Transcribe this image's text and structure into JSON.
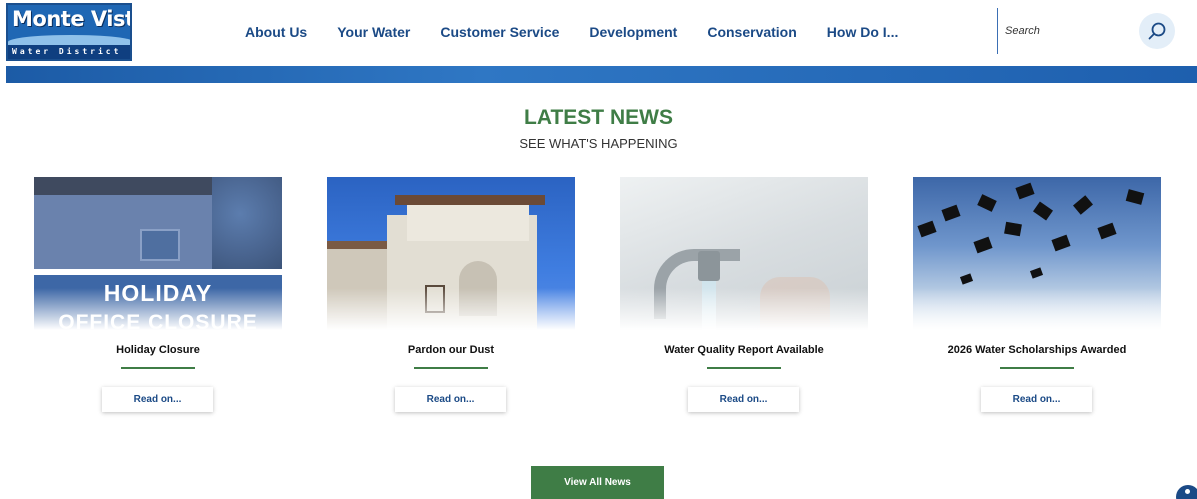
{
  "site": {
    "logo_top": "Monte Vista",
    "logo_bottom": "Water District"
  },
  "nav": {
    "items": [
      {
        "label": "About Us"
      },
      {
        "label": "Your Water"
      },
      {
        "label": "Customer Service"
      },
      {
        "label": "Development"
      },
      {
        "label": "Conservation"
      },
      {
        "label": "How Do I..."
      }
    ]
  },
  "search": {
    "placeholder": "Search",
    "icon": "search-icon"
  },
  "news": {
    "title": "LATEST NEWS",
    "subtitle": "SEE WHAT'S HAPPENING",
    "cards": [
      {
        "title": "Holiday Closure",
        "button": "Read on...",
        "image_text_1": "HOLIDAY",
        "image_text_2": "OFFICE CLOSURE"
      },
      {
        "title": "Pardon our Dust",
        "button": "Read on..."
      },
      {
        "title": "Water Quality Report Available",
        "button": "Read on..."
      },
      {
        "title": "2026 Water Scholarships Awarded",
        "button": "Read on..."
      }
    ],
    "view_all": "View All News"
  },
  "colors": {
    "brand_blue": "#1b4a86",
    "accent_green": "#3f7d46",
    "band_blue": "#1c5ba6"
  },
  "accessibility": {
    "icon": "accessibility-icon"
  }
}
